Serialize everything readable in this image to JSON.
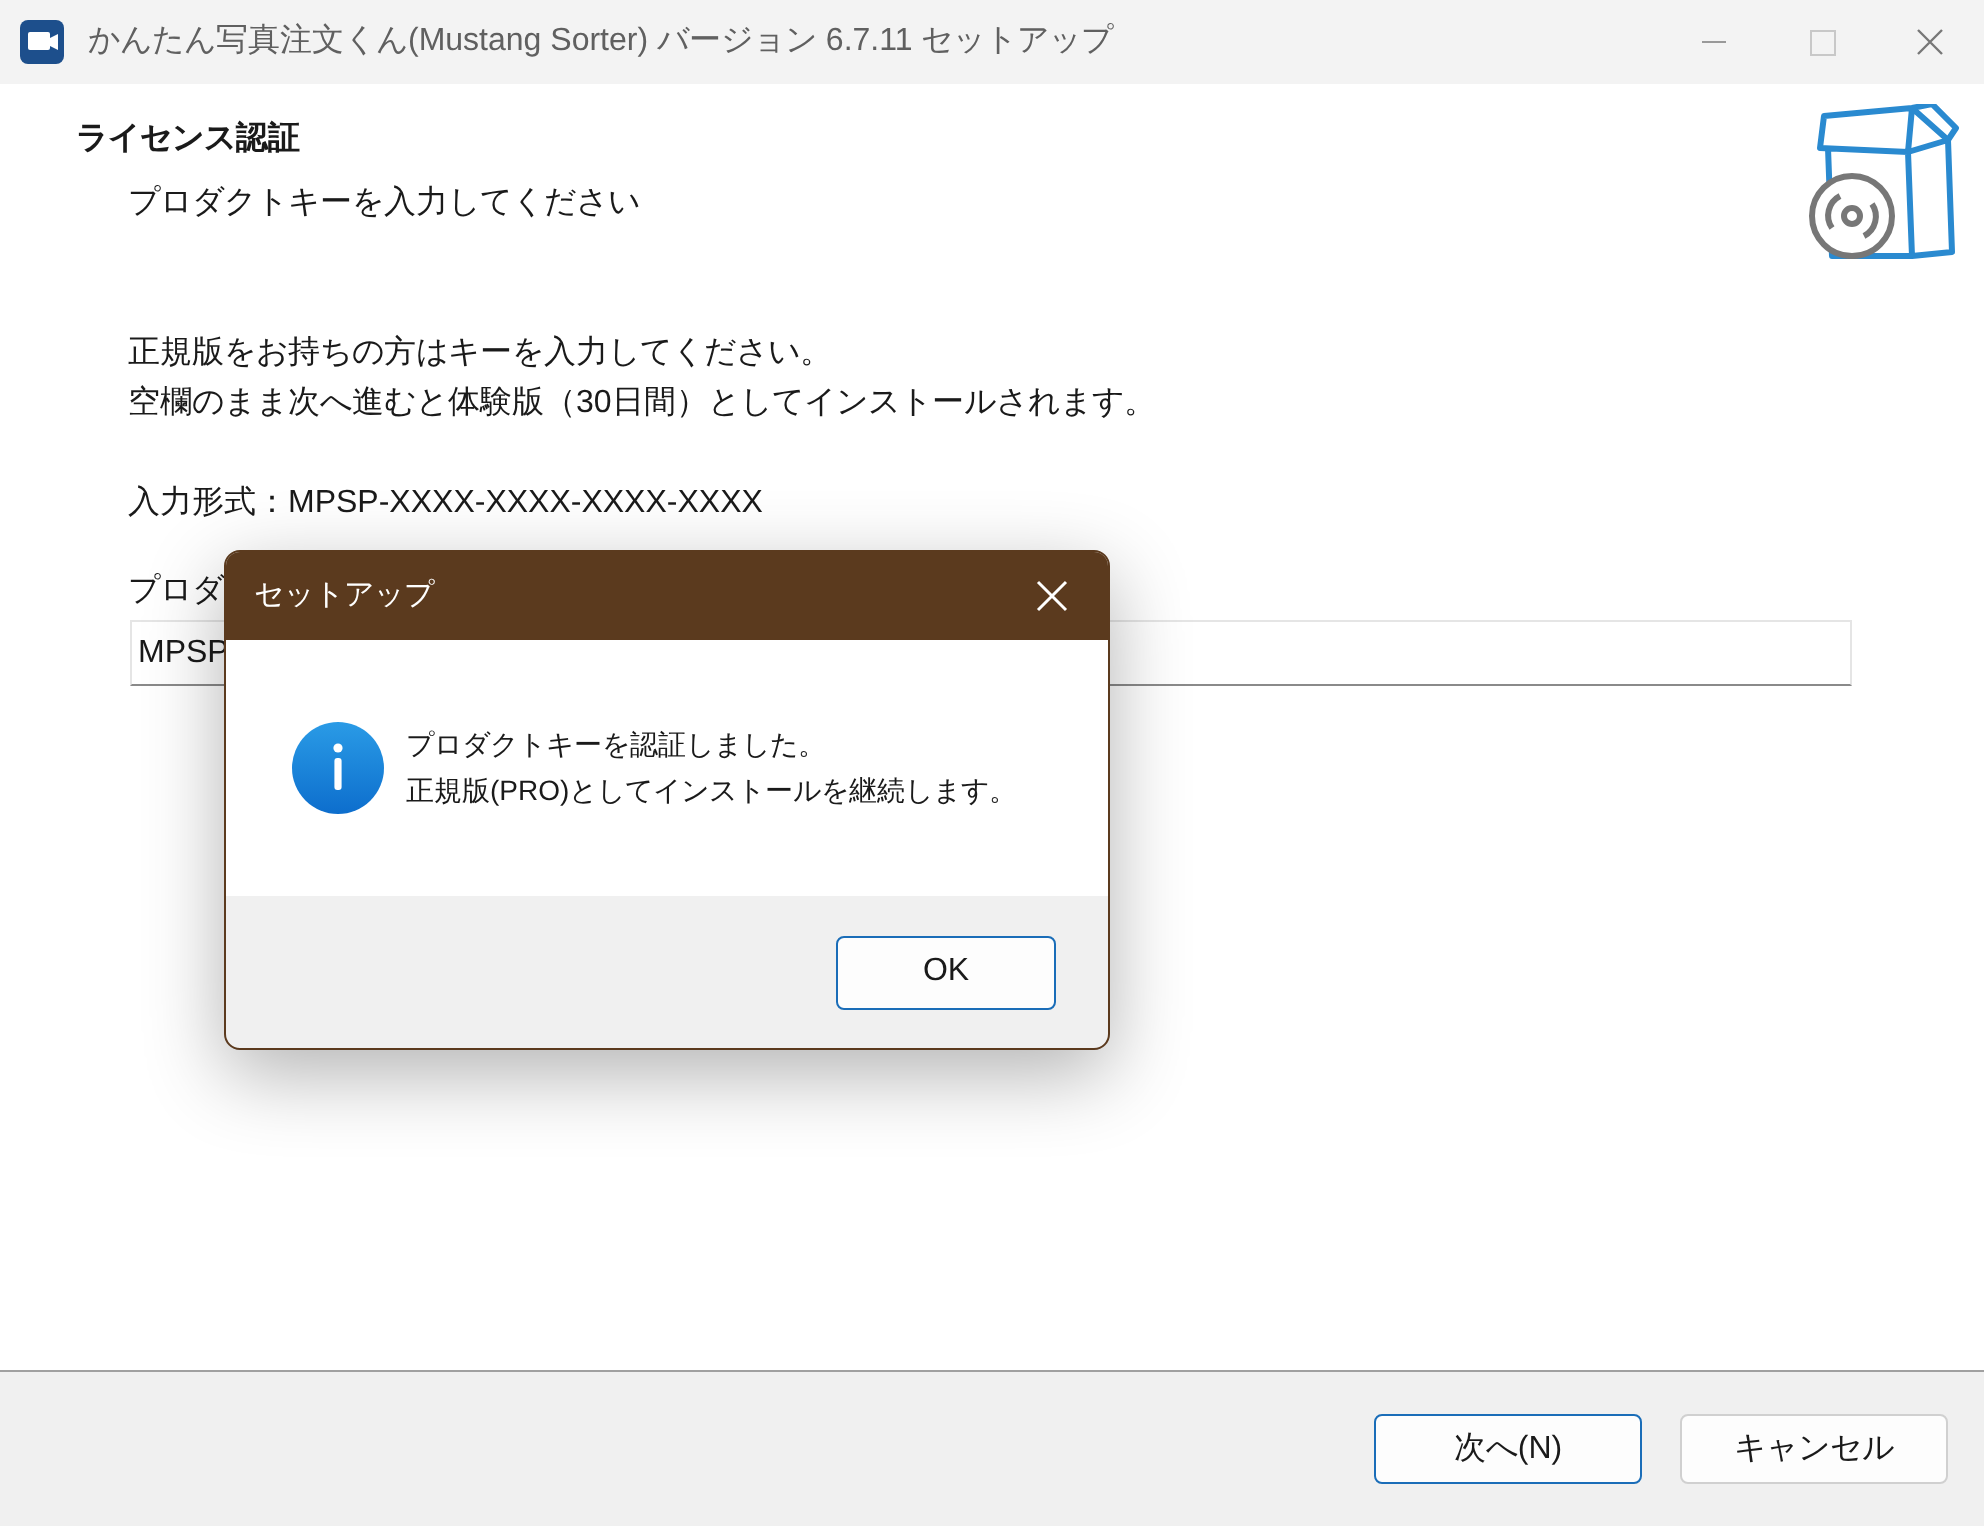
{
  "window": {
    "title": "かんたん写真注文くん(Mustang Sorter) バージョン 6.7.11 セットアップ"
  },
  "header": {
    "title": "ライセンス認証",
    "subtitle": "プロダクトキーを入力してください"
  },
  "body": {
    "lines": [
      "正規版をお持ちの方はキーを入力してください。",
      "空欄のまま次へ進むと体験版（30日間）としてインストールされます。"
    ],
    "format": "入力形式：MPSP-XXXX-XXXX-XXXX-XXXX",
    "field_label": "プロダ",
    "field_value": "MPSP"
  },
  "dialog": {
    "title": "セットアップ",
    "lines": [
      "プロダクトキーを認証しました。",
      "正規版(PRO)としてインストールを継続します。"
    ],
    "button": "OK"
  },
  "buttons": [
    "次へ(N)",
    "キャンセル"
  ]
}
